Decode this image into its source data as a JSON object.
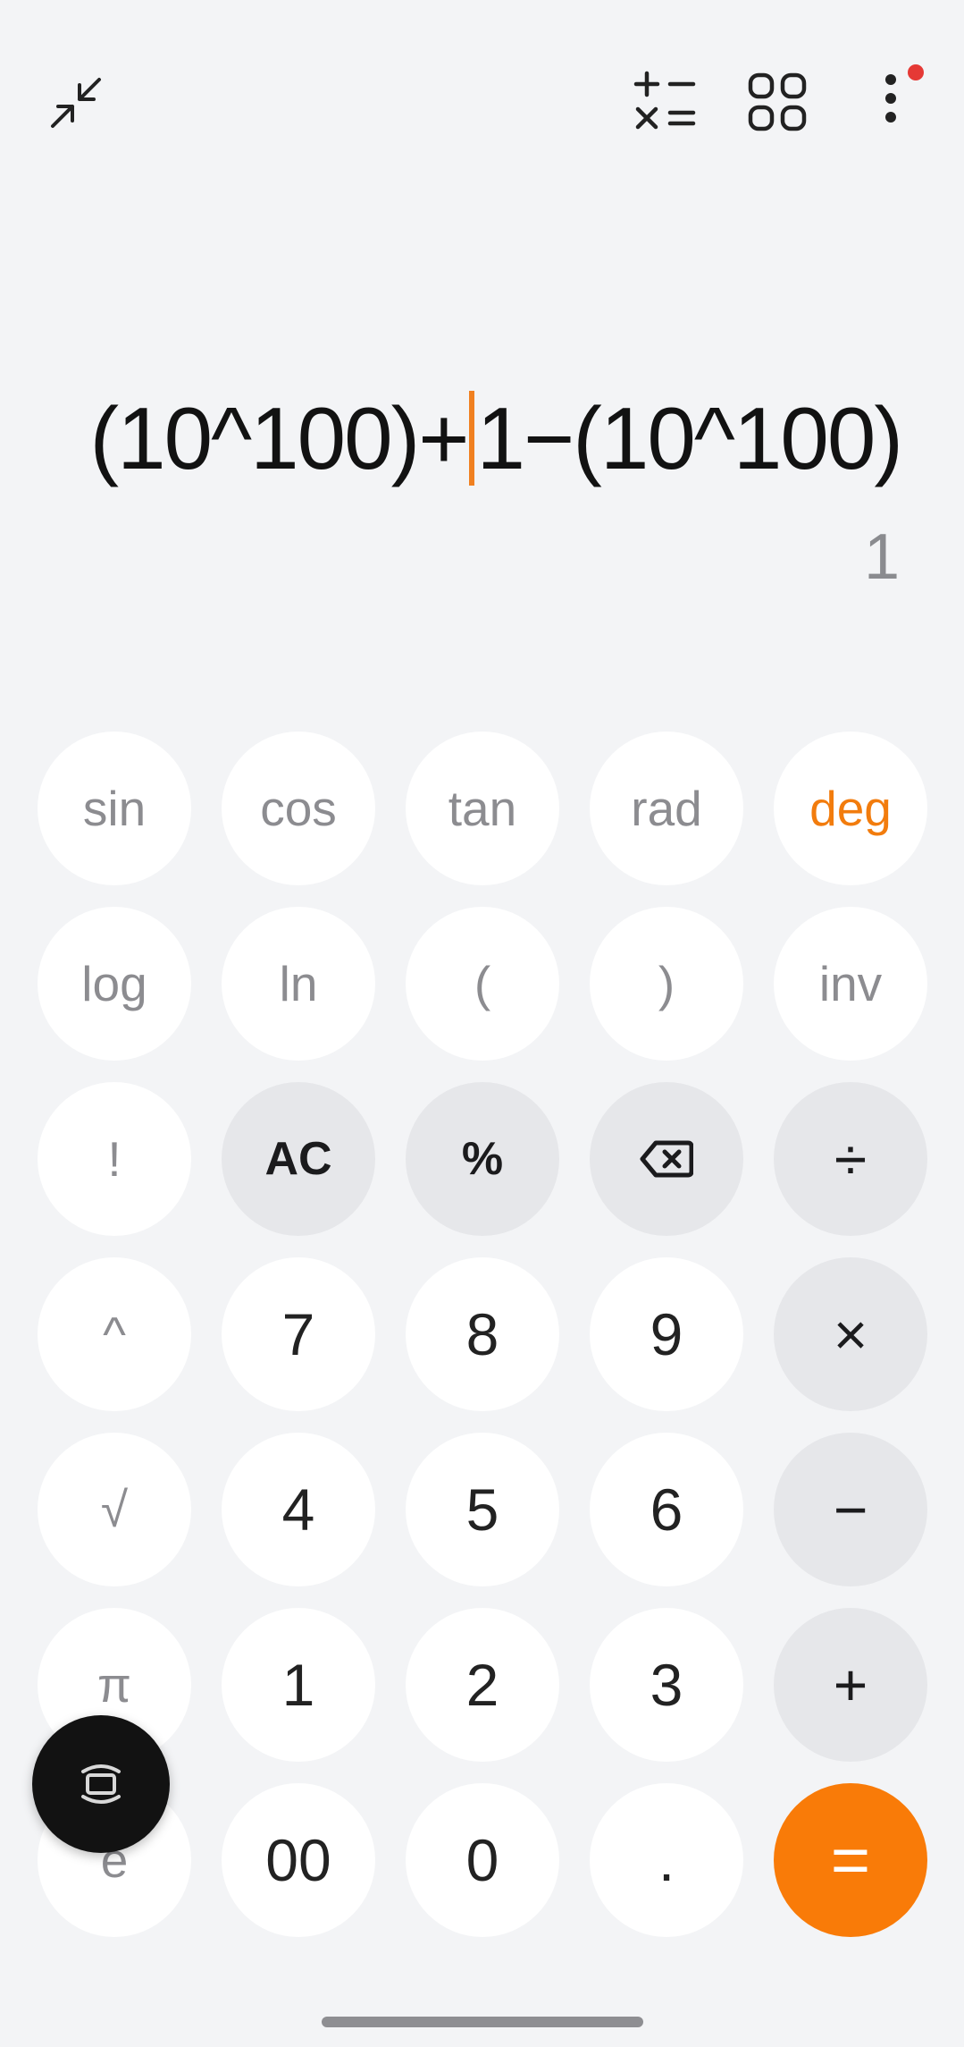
{
  "topbar": {
    "collapse_icon": "collapse-arrows-icon",
    "converter_icon": "plus-minus-times-equals-icon",
    "grid_icon": "grid-icon",
    "more_icon": "more-vert-icon",
    "notification_dot_color": "#e53935"
  },
  "display": {
    "expression_before_cursor": "(10^100)+",
    "expression_after_cursor": "1−(10^100)",
    "result": "1",
    "cursor_color": "#f08020"
  },
  "keypad": {
    "sin": "sin",
    "cos": "cos",
    "tan": "tan",
    "rad": "rad",
    "deg": "deg",
    "log": "log",
    "ln": "ln",
    "lparen": "(",
    "rparen": ")",
    "inv": "inv",
    "factorial": "!",
    "ac": "AC",
    "percent": "%",
    "backspace_icon": "backspace-icon",
    "divide": "÷",
    "power": "^",
    "seven": "7",
    "eight": "8",
    "nine": "9",
    "multiply": "×",
    "sqrt": "√",
    "four": "4",
    "five": "5",
    "six": "6",
    "minus": "−",
    "pi": "π",
    "one": "1",
    "two": "2",
    "three": "3",
    "plus": "+",
    "e": "e",
    "double_zero": "00",
    "zero": "0",
    "decimal": ".",
    "equals": "="
  },
  "colors": {
    "accent": "#f97b08",
    "background": "#f3f4f6",
    "operator_key": "#e6e7ea"
  },
  "floating": {
    "icon": "rotate-screen-icon"
  }
}
